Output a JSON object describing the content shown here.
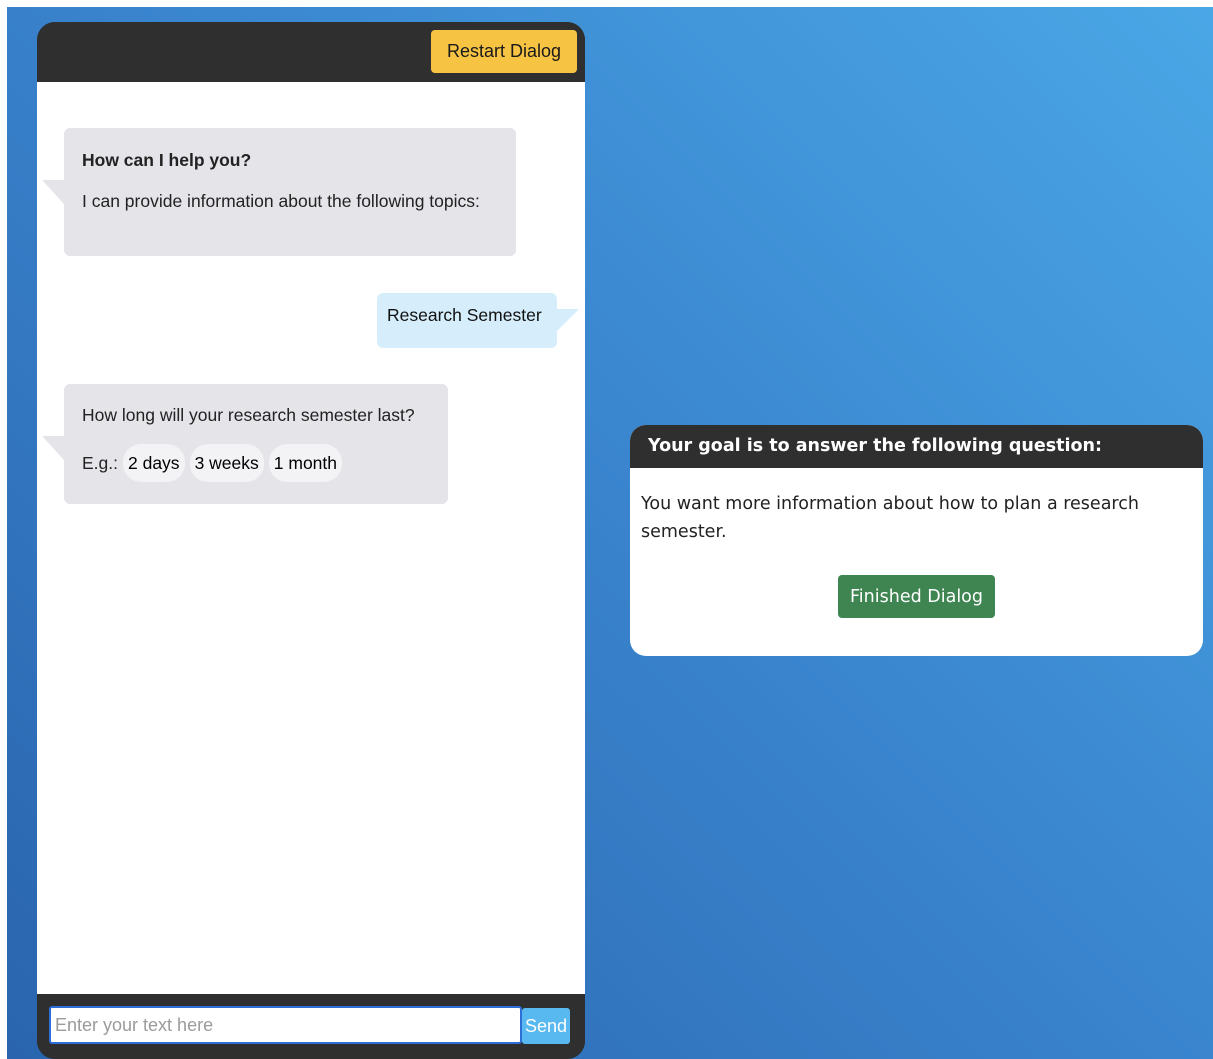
{
  "chat": {
    "restart_label": "Restart Dialog",
    "messages": [
      {
        "role": "bot",
        "title": "How can I help you?",
        "text": "I can provide information about the following topics:"
      },
      {
        "role": "user",
        "text": "Research Semester"
      },
      {
        "role": "bot",
        "text": "How long will your research semester last?",
        "examples_label": "E.g.:",
        "examples": [
          "2 days",
          "3 weeks",
          "1 month"
        ]
      }
    ],
    "input": {
      "placeholder": "Enter your text here",
      "value": ""
    },
    "send_label": "Send"
  },
  "goal": {
    "header": "Your goal is to answer the following question:",
    "text": "You want more information about how to plan a research semester.",
    "finish_label": "Finished Dialog"
  },
  "colors": {
    "restart": "#f6c343",
    "finish": "#3e8552",
    "send": "#58b8f0",
    "bot_bubble": "#e5e4e9",
    "user_bubble": "#d6eefb"
  }
}
